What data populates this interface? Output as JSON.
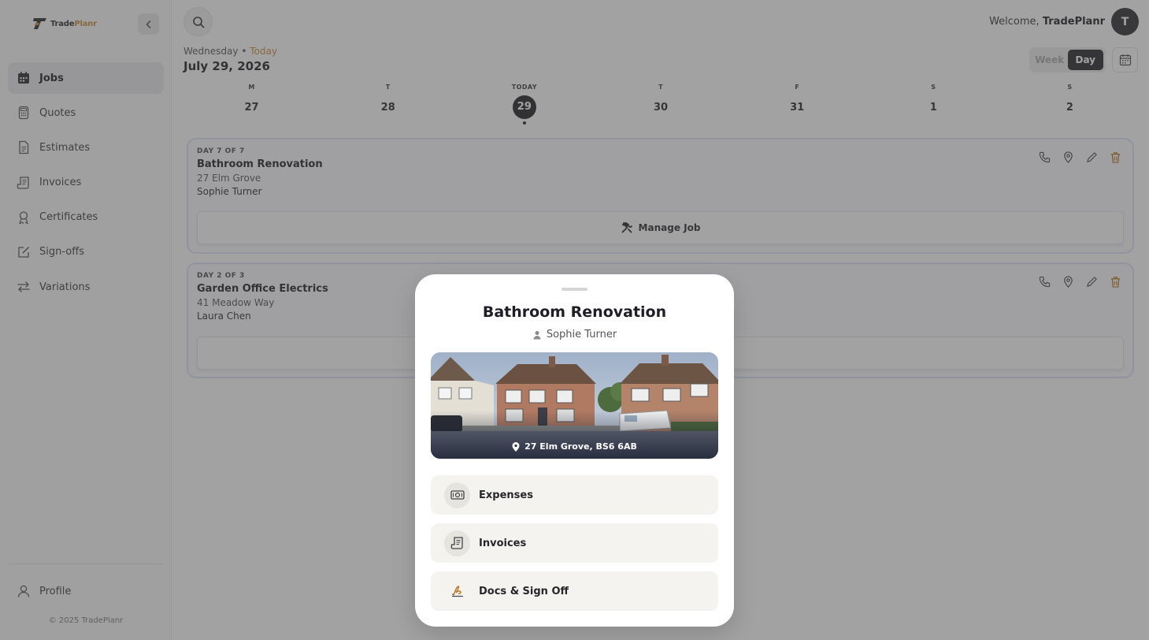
{
  "app": {
    "logo_text_main": "Trade",
    "logo_text_accent": "Planr",
    "copyright": "© 2025 TradePlanr"
  },
  "sidebar": {
    "items": [
      {
        "label": "Jobs",
        "icon": "calendar-icon",
        "active": true
      },
      {
        "label": "Quotes",
        "icon": "calculator-icon"
      },
      {
        "label": "Estimates",
        "icon": "document-icon"
      },
      {
        "label": "Invoices",
        "icon": "receipt-icon"
      },
      {
        "label": "Certificates",
        "icon": "award-icon"
      },
      {
        "label": "Sign-offs",
        "icon": "pen-square-icon"
      },
      {
        "label": "Variations",
        "icon": "swap-icon"
      }
    ],
    "profile_label": "Profile"
  },
  "header": {
    "welcome_prefix": "Welcome,",
    "welcome_name": "TradePlanr",
    "avatar_initial": "T"
  },
  "date": {
    "weekday": "Wednesday",
    "separator": "•",
    "today_label": "Today",
    "full": "July 29, 2026"
  },
  "view_toggle": {
    "week": "Week",
    "day": "Day",
    "selected": "Day"
  },
  "week_days": [
    {
      "letter": "M",
      "num": "27"
    },
    {
      "letter": "T",
      "num": "28"
    },
    {
      "letter": "TODAY",
      "num": "29",
      "current": true
    },
    {
      "letter": "T",
      "num": "30"
    },
    {
      "letter": "F",
      "num": "31"
    },
    {
      "letter": "S",
      "num": "1"
    },
    {
      "letter": "S",
      "num": "2"
    }
  ],
  "jobs": [
    {
      "kicker": "DAY 7 OF 7",
      "title": "Bathroom Renovation",
      "address": "27 Elm Grove",
      "client": "Sophie Turner",
      "manage_label": "Manage Job"
    },
    {
      "kicker": "DAY 2 OF 3",
      "title": "Garden Office Electrics",
      "address": "41 Meadow Way",
      "client": "Laura Chen",
      "manage_label": ""
    }
  ],
  "modal": {
    "title": "Bathroom Renovation",
    "client": "Sophie Turner",
    "photo_address": "27 Elm Grove, BS6 6AB",
    "rows": [
      {
        "label": "Expenses",
        "icon": "banknote-icon"
      },
      {
        "label": "Invoices",
        "icon": "receipt-icon"
      },
      {
        "label": "Docs & Sign Off",
        "icon": "signature-icon"
      }
    ]
  },
  "colors": {
    "accent": "#c98a3c",
    "dark": "#1e1e24",
    "delete": "#b8741e"
  }
}
